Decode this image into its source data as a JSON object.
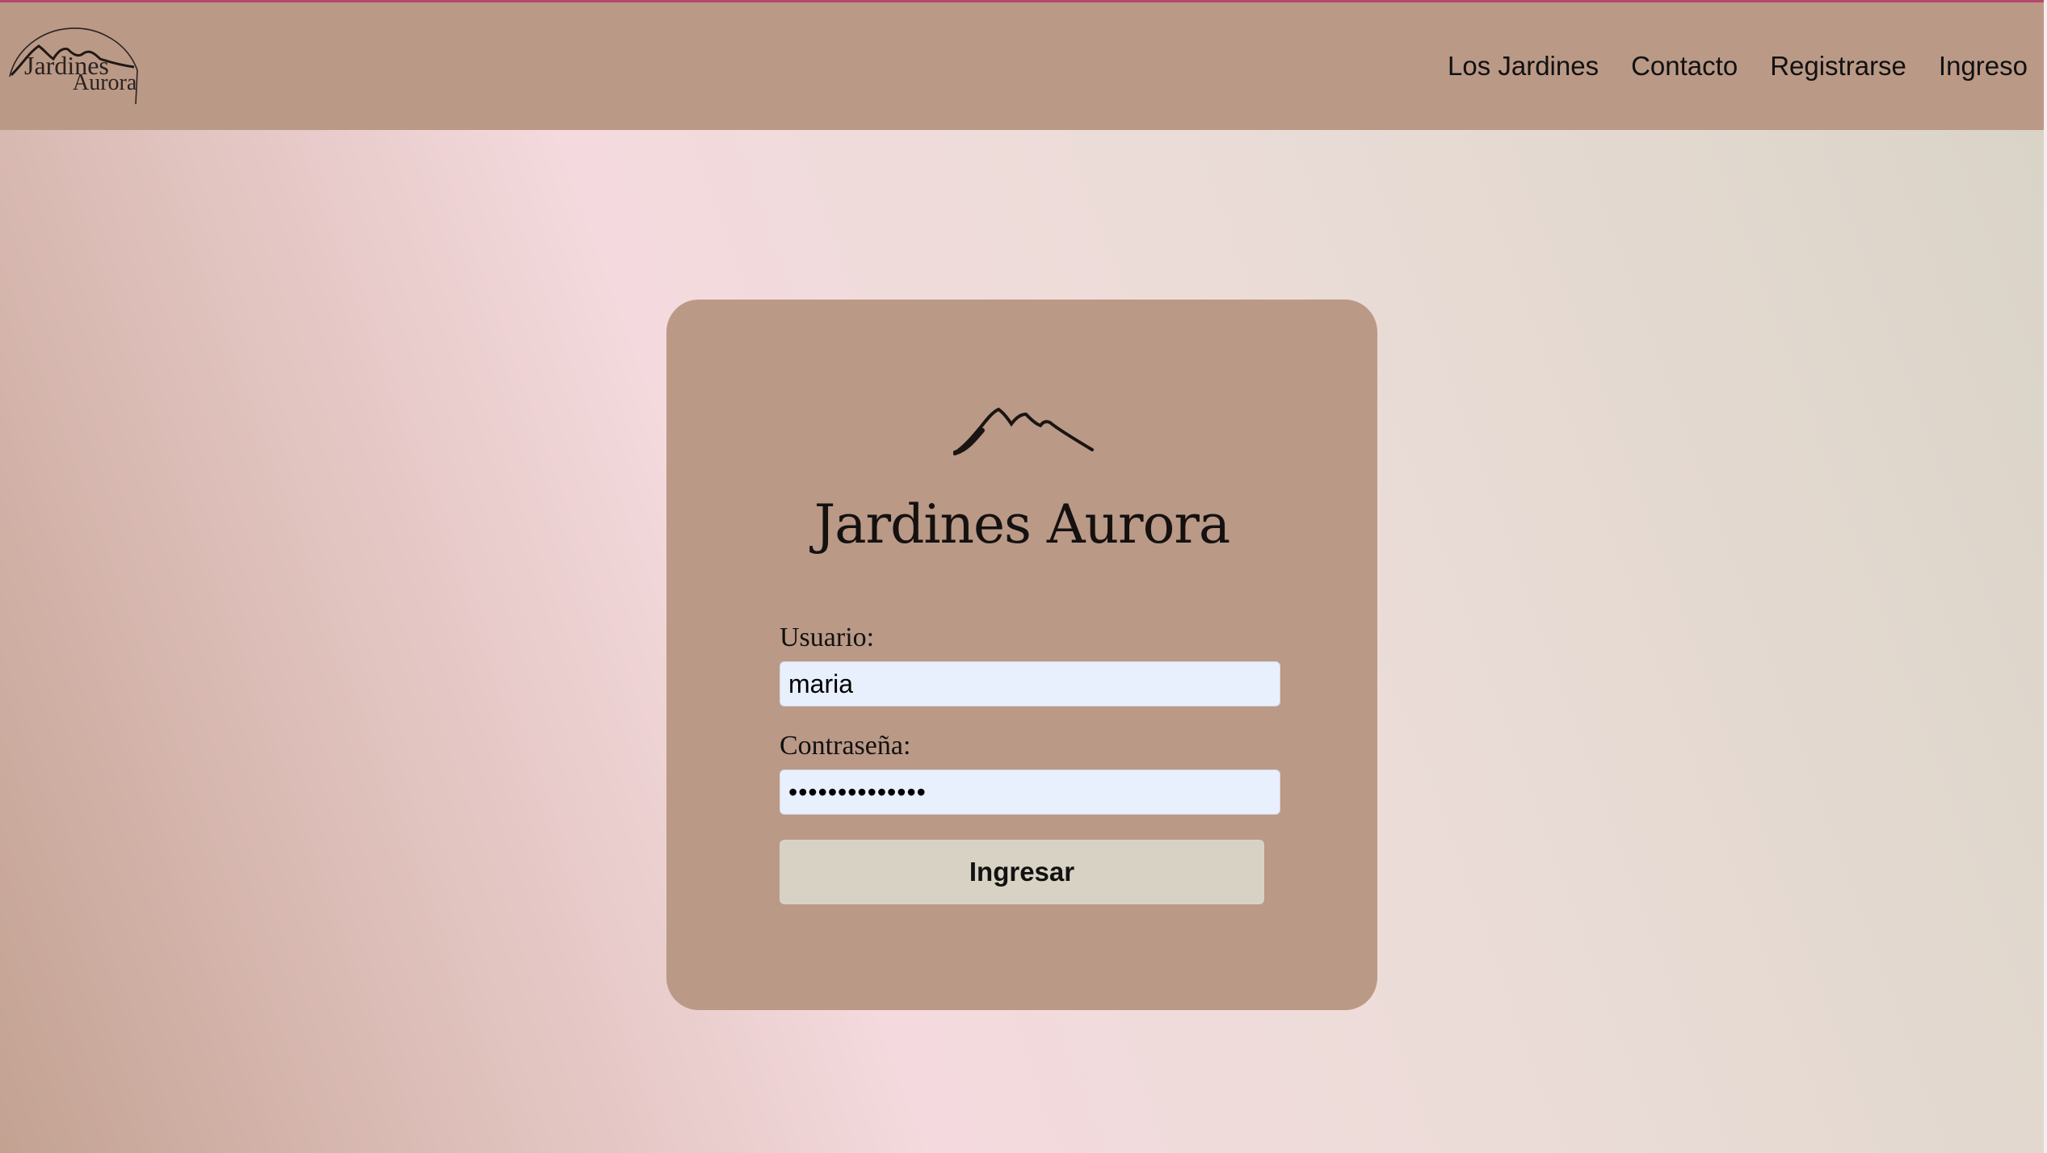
{
  "brand": {
    "logo_icon": "mountain-arc-logo",
    "logo_line1": "Jardines",
    "logo_line2": "Aurora"
  },
  "nav": {
    "items": [
      {
        "label": "Los Jardines"
      },
      {
        "label": "Contacto"
      },
      {
        "label": "Registrarse"
      },
      {
        "label": "Ingreso"
      }
    ]
  },
  "login": {
    "icon": "mountain-icon",
    "title": "Jardines Aurora",
    "username_label": "Usuario:",
    "username_value": "maria",
    "password_label": "Contraseña:",
    "password_value": "••••••••••••••",
    "submit_label": "Ingresar"
  },
  "colors": {
    "navbar": "#ba9986",
    "card": "#ba9986",
    "input_bg": "#e8f0fe",
    "button_bg": "#d8d2c5",
    "top_accent": "#b8476e"
  }
}
